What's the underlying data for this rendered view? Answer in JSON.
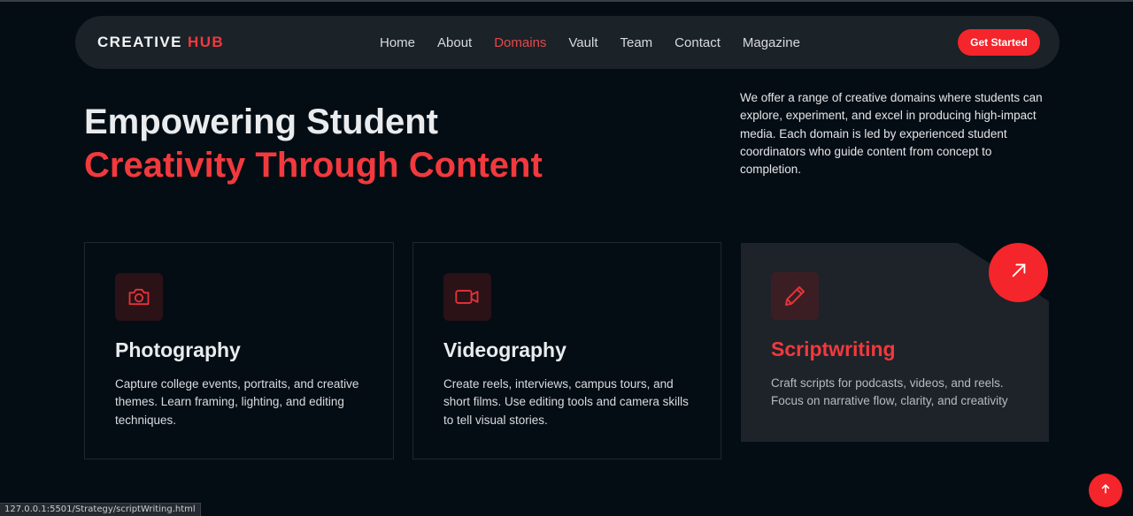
{
  "brand": {
    "name_part1": "CREATIVE",
    "name_part2": "HUB",
    "accent_color": "#f4252b"
  },
  "nav": {
    "items": [
      {
        "label": "Home",
        "active": false
      },
      {
        "label": "About",
        "active": false
      },
      {
        "label": "Domains",
        "active": true
      },
      {
        "label": "Vault",
        "active": false
      },
      {
        "label": "Team",
        "active": false
      },
      {
        "label": "Contact",
        "active": false
      },
      {
        "label": "Magazine",
        "active": false
      }
    ],
    "cta_label": "Get Started"
  },
  "hero": {
    "title_line1": "Empowering Student",
    "title_line2": "Creativity Through Content",
    "description": "We offer a range of creative domains where students can explore, experiment, and excel in producing high-impact media. Each domain is led by experienced student coordinators who guide content from concept to completion."
  },
  "cards": [
    {
      "icon": "camera-icon",
      "title": "Photography",
      "description": "Capture college events, portraits, and creative themes. Learn framing, lighting, and editing techniques."
    },
    {
      "icon": "video-camera-icon",
      "title": "Videography",
      "description": "Create reels, interviews, campus tours, and short films. Use editing tools and camera skills to tell visual stories."
    },
    {
      "icon": "pencil-icon",
      "title": "Scriptwriting",
      "description": "Craft scripts for podcasts, videos, and reels. Focus on narrative flow, clarity, and creativity",
      "highlighted": true
    }
  ],
  "status_url": "127.0.0.1:5501/Strategy/scriptWriting.html"
}
